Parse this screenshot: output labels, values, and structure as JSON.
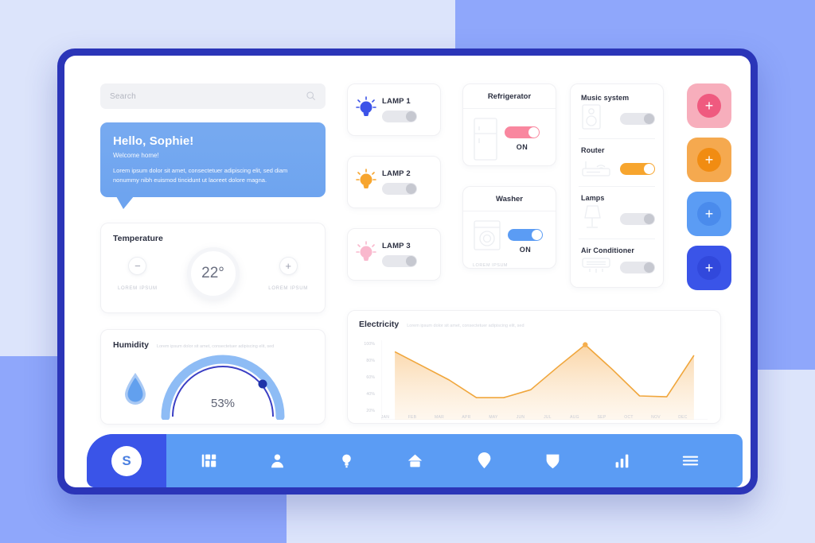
{
  "search": {
    "placeholder": "Search",
    "icon": "search-icon"
  },
  "greeting": {
    "title": "Hello, Sophie!",
    "subtitle": "Welcome home!",
    "body": "Lorem ipsum dolor sit amet, consectetuer adipiscing elit, sed diam nonummy nibh euismod tincidunt ut laoreet dolore magna."
  },
  "temperature": {
    "title": "Temperature",
    "value": "22°",
    "decrease_label": "−",
    "increase_label": "+",
    "left_caption": "LOREM IPSUM",
    "right_caption": "LOREM IPSUM"
  },
  "humidity": {
    "title": "Humidity",
    "lorem": "Lorem ipsum dolor sit amet, consectetuer adipiscing elit, sed",
    "value": "53%",
    "percent": 53
  },
  "lamps": [
    {
      "name": "LAMP 1",
      "state": "off",
      "color": "#3c53e8"
    },
    {
      "name": "LAMP 2",
      "state": "off",
      "color": "#f7a52e"
    },
    {
      "name": "LAMP 3",
      "state": "off",
      "color": "#f9b8cd"
    }
  ],
  "appliances": [
    {
      "name": "Refrigerator",
      "status": "ON",
      "state": "on",
      "accent": "pink",
      "lorem": ""
    },
    {
      "name": "Washer",
      "status": "ON",
      "state": "on",
      "accent": "blue",
      "lorem": "LOREM IPSUM"
    }
  ],
  "devices": [
    {
      "name": "Music system",
      "state": "off",
      "accent": ""
    },
    {
      "name": "Router",
      "state": "on",
      "accent": "orange"
    },
    {
      "name": "Lamps",
      "state": "off",
      "accent": ""
    },
    {
      "name": "Air Conditioner",
      "state": "off",
      "accent": ""
    }
  ],
  "plus_buttons": [
    {
      "label": "+",
      "bg": "#f7aebc",
      "inner": "#ef5a7f"
    },
    {
      "label": "+",
      "bg": "#f5a94f",
      "inner": "#f18c12"
    },
    {
      "label": "+",
      "bg": "#5b9cf4",
      "inner": "#4a8bec"
    },
    {
      "label": "+",
      "bg": "#3a54e8",
      "inner": "#3148dc"
    }
  ],
  "chart_data": {
    "type": "area",
    "title": "Electricity",
    "subtitle": "Lorem ipsum dolor sit amet, consectetuer adipiscing elit, sed",
    "categories": [
      "JAN",
      "FEB",
      "MAR",
      "APR",
      "MAY",
      "JUN",
      "JUL",
      "AUG",
      "SEP",
      "OCT",
      "NOV",
      "DEC"
    ],
    "values": [
      97,
      81,
      65,
      45,
      45,
      54,
      80,
      105,
      77,
      47,
      46,
      93
    ],
    "ytick_labels": [
      "100%",
      "80%",
      "60%",
      "40%",
      "20%"
    ],
    "yticks": [
      100,
      80,
      60,
      40,
      20
    ],
    "ylim": [
      20,
      110
    ],
    "xlabel": "",
    "ylabel": "",
    "grid": false,
    "legend": "none",
    "line_color": "#f0a63c",
    "fill_color": "#fbdcb0",
    "highlight_point": {
      "category": "AUG",
      "value": 105
    }
  },
  "nav": {
    "brand_initial": "S",
    "items": [
      {
        "icon": "dashboard-grid-icon"
      },
      {
        "icon": "user-icon"
      },
      {
        "icon": "lightbulb-icon"
      },
      {
        "icon": "home-icon"
      },
      {
        "icon": "location-pin-icon"
      },
      {
        "icon": "shield-icon"
      },
      {
        "icon": "bar-chart-icon"
      },
      {
        "icon": "hamburger-menu-icon"
      }
    ]
  }
}
